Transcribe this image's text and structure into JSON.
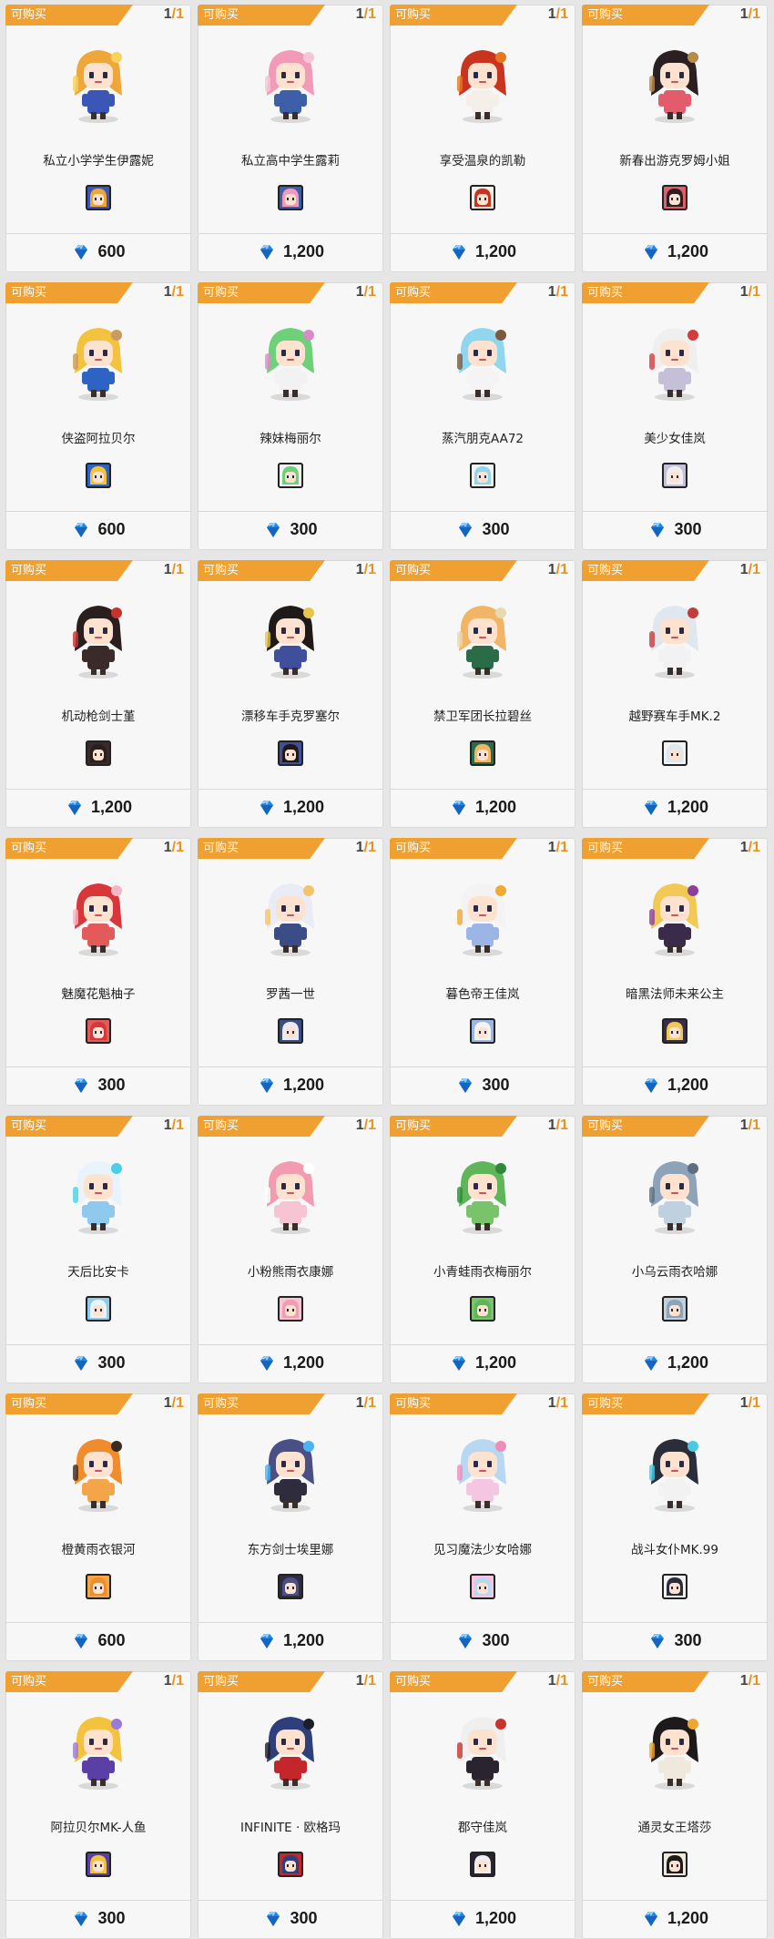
{
  "shop": {
    "items": [
      {
        "tag": "可购买",
        "qty": "1",
        "max": "1",
        "name": "私立小学学生伊露妮",
        "price": "600",
        "hair": "#f0a73a",
        "cloth": "#3a57b8",
        "accent": "#f6d35b"
      },
      {
        "tag": "可购买",
        "qty": "1",
        "max": "1",
        "name": "私立高中学生露莉",
        "price": "1,200",
        "hair": "#f29ab8",
        "cloth": "#3c5fa8",
        "accent": "#f6c6d6"
      },
      {
        "tag": "可购买",
        "qty": "1",
        "max": "1",
        "name": "享受温泉的凯勒",
        "price": "1,200",
        "hair": "#c8341d",
        "cloth": "#f4efe8",
        "accent": "#e8761f"
      },
      {
        "tag": "可购买",
        "qty": "1",
        "max": "1",
        "name": "新春出游克罗姆小姐",
        "price": "1,200",
        "hair": "#2a2022",
        "cloth": "#e25c6c",
        "accent": "#b88a4a"
      },
      {
        "tag": "可购买",
        "qty": "1",
        "max": "1",
        "name": "侠盗阿拉贝尔",
        "price": "600",
        "hair": "#f3c23e",
        "cloth": "#2d63c4",
        "accent": "#c99b5e"
      },
      {
        "tag": "可购买",
        "qty": "1",
        "max": "1",
        "name": "辣妹梅丽尔",
        "price": "300",
        "hair": "#6fd07a",
        "cloth": "#f2f2f2",
        "accent": "#d98cc4"
      },
      {
        "tag": "可购买",
        "qty": "1",
        "max": "1",
        "name": "蒸汽朋克AA72",
        "price": "300",
        "hair": "#8fd6ee",
        "cloth": "#f4f4f4",
        "accent": "#7b5a3e"
      },
      {
        "tag": "可购买",
        "qty": "1",
        "max": "1",
        "name": "美少女佳岚",
        "price": "300",
        "hair": "#efefef",
        "cloth": "#c5c0d8",
        "accent": "#d33c3c"
      },
      {
        "tag": "可购买",
        "qty": "1",
        "max": "1",
        "name": "机动枪剑士堇",
        "price": "1,200",
        "hair": "#2a1e1e",
        "cloth": "#3b2a2a",
        "accent": "#c8332e"
      },
      {
        "tag": "可购买",
        "qty": "1",
        "max": "1",
        "name": "漂移车手克罗塞尔",
        "price": "1,200",
        "hair": "#1f1a18",
        "cloth": "#3f4f9c",
        "accent": "#e7c44c"
      },
      {
        "tag": "可购买",
        "qty": "1",
        "max": "1",
        "name": "禁卫军团长拉碧丝",
        "price": "1,200",
        "hair": "#f1b565",
        "cloth": "#2a6c48",
        "accent": "#e9d8b0"
      },
      {
        "tag": "可购买",
        "qty": "1",
        "max": "1",
        "name": "越野赛车手MK.2",
        "price": "1,200",
        "hair": "#dfe7ef",
        "cloth": "#f2f2f2",
        "accent": "#c33c3c"
      },
      {
        "tag": "可购买",
        "qty": "1",
        "max": "1",
        "name": "魅魔花魁柚子",
        "price": "300",
        "hair": "#d8363b",
        "cloth": "#e25a5a",
        "accent": "#f1b7c2"
      },
      {
        "tag": "可购买",
        "qty": "1",
        "max": "1",
        "name": "罗茜一世",
        "price": "1,200",
        "hair": "#e9ecf4",
        "cloth": "#3a4d86",
        "accent": "#f1c66a"
      },
      {
        "tag": "可购买",
        "qty": "1",
        "max": "1",
        "name": "暮色帝王佳岚",
        "price": "300",
        "hair": "#f3f3f3",
        "cloth": "#9bb6e6",
        "accent": "#f0a934"
      },
      {
        "tag": "可购买",
        "qty": "1",
        "max": "1",
        "name": "暗黑法师未来公主",
        "price": "1,200",
        "hair": "#f3c955",
        "cloth": "#3b2b4a",
        "accent": "#8c3f9a"
      },
      {
        "tag": "可购买",
        "qty": "1",
        "max": "1",
        "name": "天后比安卡",
        "price": "300",
        "hair": "#e9f3fb",
        "cloth": "#8fc9ee",
        "accent": "#4ad0e6"
      },
      {
        "tag": "可购买",
        "qty": "1",
        "max": "1",
        "name": "小粉熊雨衣康娜",
        "price": "1,200",
        "hair": "#f29bb1",
        "cloth": "#f6c4d2",
        "accent": "#ffffff"
      },
      {
        "tag": "可购买",
        "qty": "1",
        "max": "1",
        "name": "小青蛙雨衣梅丽尔",
        "price": "1,200",
        "hair": "#5fb65a",
        "cloth": "#79c36b",
        "accent": "#2e8a3a"
      },
      {
        "tag": "可购买",
        "qty": "1",
        "max": "1",
        "name": "小乌云雨衣哈娜",
        "price": "1,200",
        "hair": "#8ea3b8",
        "cloth": "#bfd0df",
        "accent": "#5d6f83"
      },
      {
        "tag": "可购买",
        "qty": "1",
        "max": "1",
        "name": "橙黄雨衣银河",
        "price": "600",
        "hair": "#f08c2c",
        "cloth": "#f3a548",
        "accent": "#3b2a1e"
      },
      {
        "tag": "可购买",
        "qty": "1",
        "max": "1",
        "name": "东方剑士埃里娜",
        "price": "1,200",
        "hair": "#4a4f86",
        "cloth": "#2f2c3e",
        "accent": "#4bb3f4"
      },
      {
        "tag": "可购买",
        "qty": "1",
        "max": "1",
        "name": "见习魔法少女哈娜",
        "price": "300",
        "hair": "#b8d8f2",
        "cloth": "#f5c6e2",
        "accent": "#f18dba"
      },
      {
        "tag": "可购买",
        "qty": "1",
        "max": "1",
        "name": "战斗女仆MK.99",
        "price": "300",
        "hair": "#2a2d3a",
        "cloth": "#f2f2f2",
        "accent": "#48c9e3"
      },
      {
        "tag": "可购买",
        "qty": "1",
        "max": "1",
        "name": "阿拉贝尔MK-人鱼",
        "price": "300",
        "hair": "#f3c23e",
        "cloth": "#5a3fa6",
        "accent": "#9a7ad6"
      },
      {
        "tag": "可购买",
        "qty": "1",
        "max": "1",
        "name": "INFINITE · 欧格玛",
        "price": "300",
        "hair": "#2e3f7c",
        "cloth": "#c4262c",
        "accent": "#1a1d2c"
      },
      {
        "tag": "可购买",
        "qty": "1",
        "max": "1",
        "name": "郡守佳岚",
        "price": "1,200",
        "hair": "#efefef",
        "cloth": "#2a2430",
        "accent": "#c7342e"
      },
      {
        "tag": "可购买",
        "qty": "1",
        "max": "1",
        "name": "通灵女王塔莎",
        "price": "1,200",
        "hair": "#1e1a1c",
        "cloth": "#efe8dc",
        "accent": "#f0a530"
      }
    ]
  },
  "gem_color": "#1e88e5"
}
